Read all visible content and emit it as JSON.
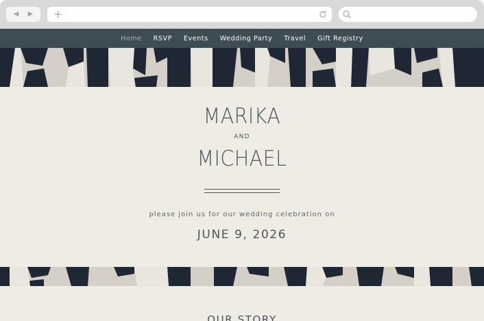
{
  "browser": {
    "back_icon": "back-arrow-icon",
    "forward_icon": "forward-arrow-icon",
    "new_tab_icon": "plus-icon",
    "reload_icon": "reload-icon",
    "search_icon": "search-icon",
    "address_value": "",
    "search_value": ""
  },
  "nav": {
    "items": [
      {
        "label": "Home",
        "active": true
      },
      {
        "label": "RSVP"
      },
      {
        "label": "Events"
      },
      {
        "label": "Wedding Party"
      },
      {
        "label": "Travel"
      },
      {
        "label": "Gift Registry"
      }
    ]
  },
  "hero": {
    "name1": "MARIKA",
    "connector": "AND",
    "name2": "MICHAEL",
    "invite_text": "please join us for our wedding celebration on",
    "date": "JUNE 9, 2026"
  },
  "story": {
    "heading": "OUR STORY"
  },
  "colors": {
    "nav_bg": "#3e4c53",
    "page_bg": "#efece5",
    "text": "#4a5659",
    "pattern_dark": "#1f2734",
    "pattern_light": "#d4d0c8"
  }
}
